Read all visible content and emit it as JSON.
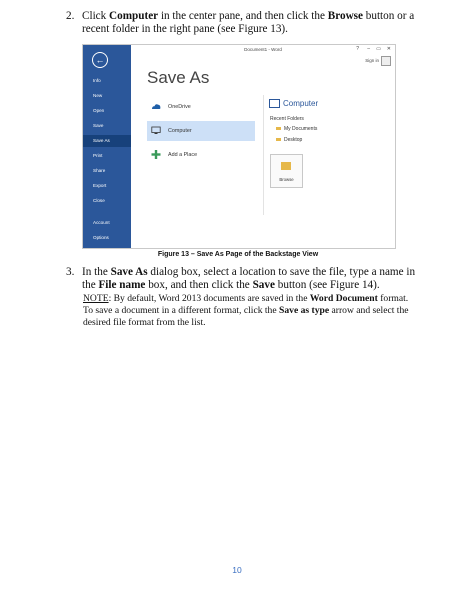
{
  "step2": {
    "number": "2.",
    "segments": [
      {
        "t": "Click ",
        "b": false
      },
      {
        "t": "Computer",
        "b": true
      },
      {
        "t": " in the center pane, and then click the ",
        "b": false
      },
      {
        "t": "Browse",
        "b": true
      },
      {
        "t": " button or a recent folder in the right pane (see Figure 13).",
        "b": false
      }
    ]
  },
  "figure": {
    "window_title": "Document1 - Word",
    "window_controls": [
      "?",
      "–",
      "▭",
      "✕"
    ],
    "sign_in": "Sign in",
    "nav": [
      "Info",
      "New",
      "Open",
      "Save",
      "Save As",
      "Print",
      "Share",
      "Export",
      "Close",
      "Account",
      "Options"
    ],
    "nav_active": "Save As",
    "heading": "Save As",
    "places": [
      {
        "label": "OneDrive",
        "icon": "cloud-icon",
        "selected": false
      },
      {
        "label": "Computer",
        "icon": "monitor-icon",
        "selected": true
      },
      {
        "label": "Add a Place",
        "icon": "plus-icon",
        "selected": false
      }
    ],
    "right_heading": "Computer",
    "recent_label": "Recent Folders",
    "folders": [
      "My Documents",
      "Desktop"
    ],
    "browse_label": "Browse",
    "colors": {
      "sidebar": "#2b579a",
      "accent": "#2b579a",
      "selected": "#cde0f7"
    }
  },
  "caption": "Figure 13 – Save As Page of the Backstage View",
  "step3": {
    "number": "3.",
    "segments": [
      {
        "t": "In the ",
        "b": false
      },
      {
        "t": "Save As",
        "b": true
      },
      {
        "t": " dialog box, select a location to save the file, type a name in the ",
        "b": false
      },
      {
        "t": "File name",
        "b": true
      },
      {
        "t": " box, and then click the ",
        "b": false
      },
      {
        "t": "Save",
        "b": true
      },
      {
        "t": " button (see Figure 14).",
        "b": false
      }
    ]
  },
  "note": {
    "label": "NOTE",
    "segments": [
      {
        "t": ": By default, Word 2013 documents are saved in the ",
        "b": false
      },
      {
        "t": "Word Document",
        "b": true
      },
      {
        "t": " format. To save a document in a different format, click the ",
        "b": false
      },
      {
        "t": "Save as type",
        "b": true
      },
      {
        "t": " arrow and select the desired file format from the list.",
        "b": false
      }
    ]
  },
  "page_number": "10"
}
